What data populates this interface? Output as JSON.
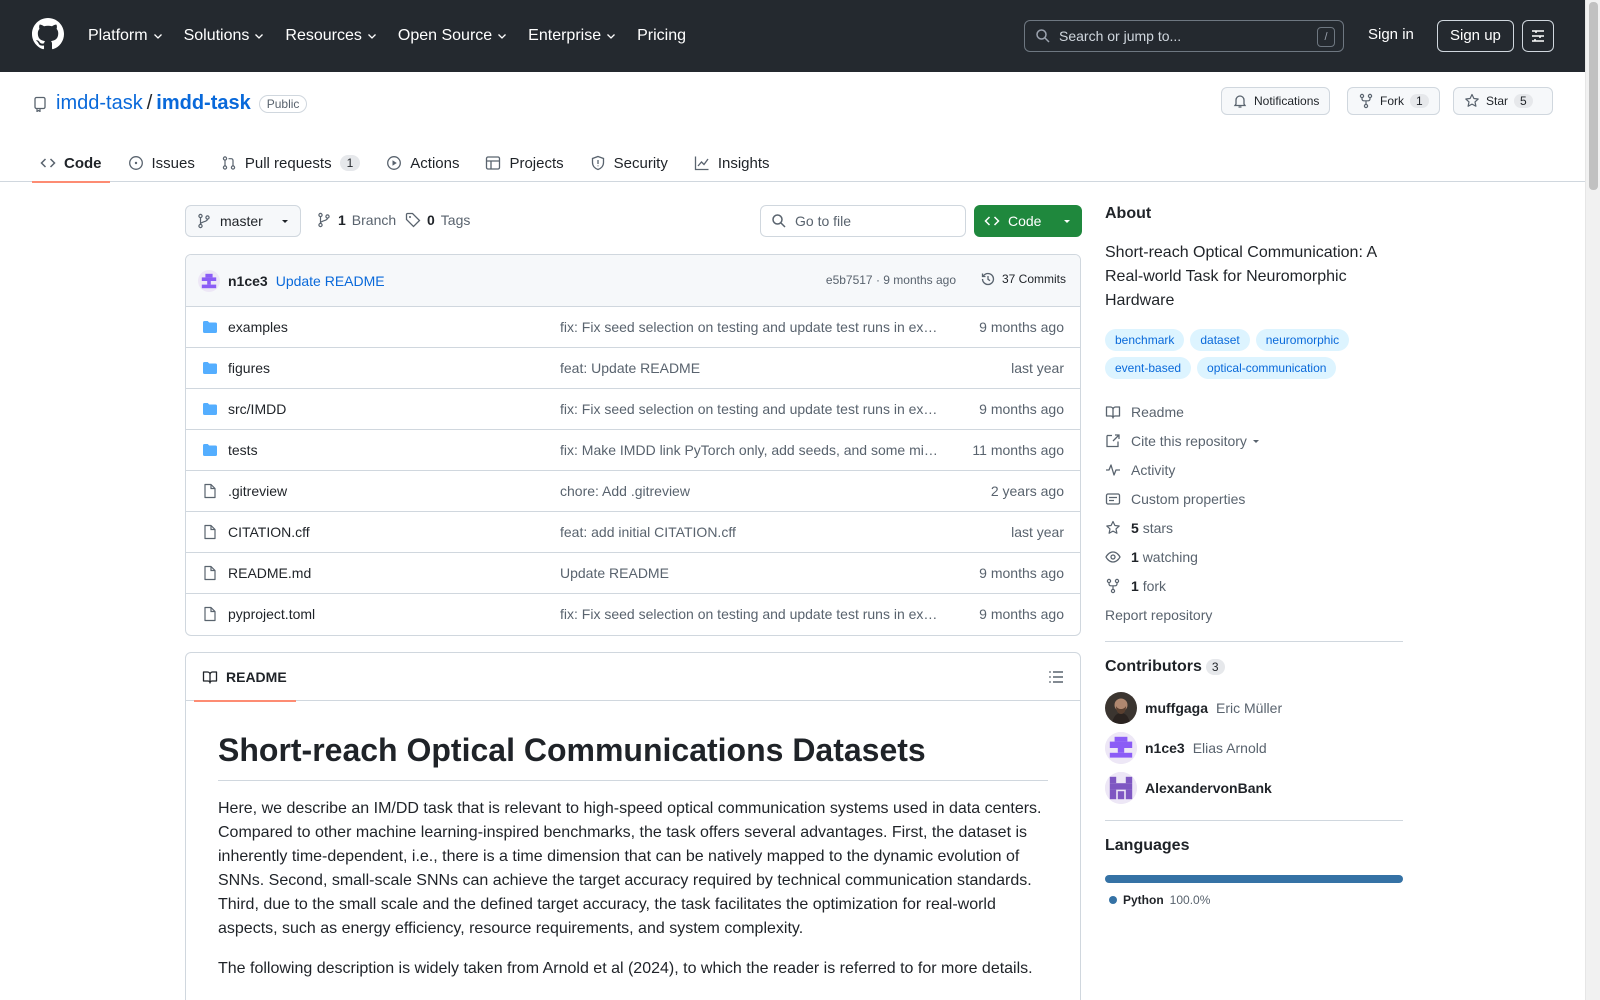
{
  "header": {
    "nav": [
      "Platform",
      "Solutions",
      "Resources",
      "Open Source",
      "Enterprise",
      "Pricing"
    ],
    "search_placeholder": "Search or jump to...",
    "search_shortcut": "/",
    "signin": "Sign in",
    "signup": "Sign up"
  },
  "repo": {
    "owner": "imdd-task",
    "sep": "/",
    "name": "imdd-task",
    "visibility": "Public",
    "notifications": "Notifications",
    "fork_label": "Fork",
    "fork_count": "1",
    "star_label": "Star",
    "star_count": "5"
  },
  "tabs": [
    {
      "label": "Code"
    },
    {
      "label": "Issues"
    },
    {
      "label": "Pull requests",
      "count": "1"
    },
    {
      "label": "Actions"
    },
    {
      "label": "Projects"
    },
    {
      "label": "Security"
    },
    {
      "label": "Insights"
    }
  ],
  "branchbar": {
    "branch": "master",
    "branches_count": "1",
    "branches_label": "Branch",
    "tags_count": "0",
    "tags_label": "Tags",
    "go_to_file": "Go to file",
    "code_button": "Code"
  },
  "latest_commit": {
    "author": "n1ce3",
    "message": "Update README",
    "meta": "e5b7517 · 9 months ago",
    "commits": "37 Commits"
  },
  "files": [
    {
      "name": "examples",
      "type": "dir",
      "message": "fix: Fix seed selection on testing and update test runs in ex…",
      "date": "9 months ago"
    },
    {
      "name": "figures",
      "type": "dir",
      "message": "feat: Update README",
      "date": "last year"
    },
    {
      "name": "src/IMDD",
      "type": "dir",
      "message": "fix: Fix seed selection on testing and update test runs in ex…",
      "date": "9 months ago"
    },
    {
      "name": "tests",
      "type": "dir",
      "message": "fix: Make IMDD link PyTorch only, add seeds, and some mi…",
      "date": "11 months ago"
    },
    {
      "name": ".gitreview",
      "type": "file",
      "message": "chore: Add .gitreview",
      "date": "2 years ago"
    },
    {
      "name": "CITATION.cff",
      "type": "file",
      "message": "feat: add initial CITATION.cff",
      "date": "last year"
    },
    {
      "name": "README.md",
      "type": "file",
      "message": "Update README",
      "date": "9 months ago"
    },
    {
      "name": "pyproject.toml",
      "type": "file",
      "message": "fix: Fix seed selection on testing and update test runs in ex…",
      "date": "9 months ago"
    }
  ],
  "readme": {
    "tab": "README",
    "title": "Short-reach Optical Communications Datasets",
    "p1": "Here, we describe an IM/DD task that is relevant to high-speed optical communication systems used in data centers. Compared to other machine learning-inspired benchmarks, the task offers several advantages. First, the dataset is inherently time-dependent, i.e., there is a time dimension that can be natively mapped to the dynamic evolution of SNNs. Second, small-scale SNNs can achieve the target accuracy required by technical communication standards. Third, due to the small scale and the defined target accuracy, the task facilitates the optimization for real-world aspects, such as energy efficiency, resource requirements, and system complexity.",
    "p2": "The following description is widely taken from Arnold et al (2024), to which the reader is referred to for more details."
  },
  "about": {
    "title": "About",
    "description": "Short-reach Optical Communication: A Real-world Task for Neuromorphic Hardware",
    "topics": [
      "benchmark",
      "dataset",
      "neuromorphic",
      "event-based",
      "optical-communication"
    ],
    "links": {
      "readme": "Readme",
      "cite": "Cite this repository",
      "activity": "Activity",
      "custom": "Custom properties",
      "stars_count": "5",
      "stars_label": "stars",
      "watching_count": "1",
      "watching_label": "watching",
      "fork_count": "1",
      "fork_label": "fork",
      "report": "Report repository"
    }
  },
  "contributors": {
    "title": "Contributors",
    "count": "3",
    "list": [
      {
        "login": "muffgaga",
        "name": "Eric Müller"
      },
      {
        "login": "n1ce3",
        "name": "Elias Arnold"
      },
      {
        "login": "AlexandervonBank",
        "name": ""
      }
    ]
  },
  "languages": {
    "title": "Languages",
    "items": [
      {
        "name": "Python",
        "percent": "100.0%",
        "color": "#3572A5",
        "share": 1.0
      }
    ]
  },
  "colors": {
    "header_bg": "#24292f",
    "link": "#0969da",
    "code_button": "#1f883d",
    "tab_underline": "#fd8c73"
  }
}
